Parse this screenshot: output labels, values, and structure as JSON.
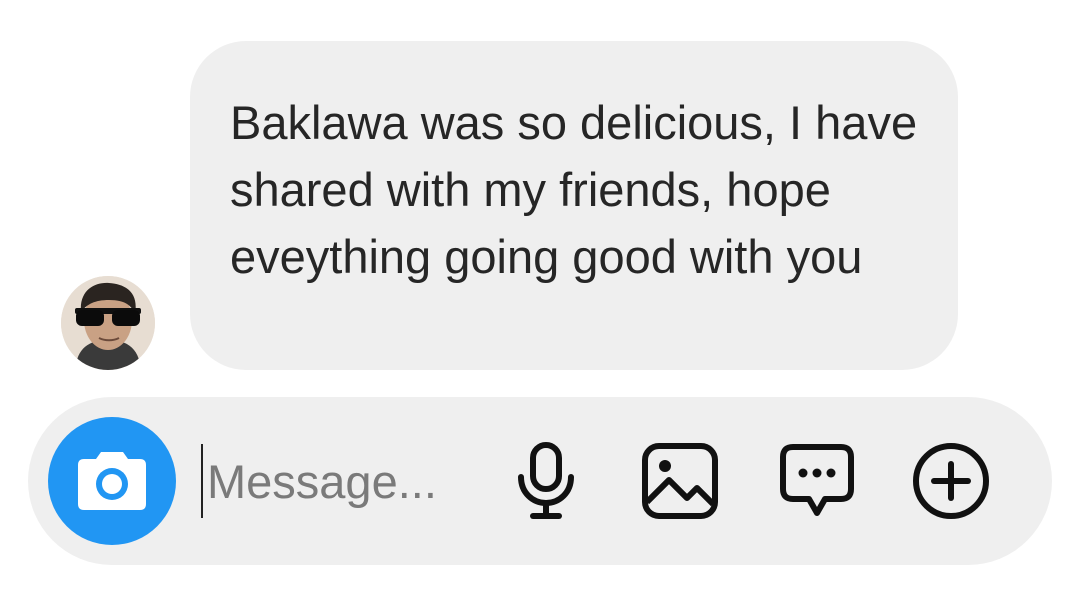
{
  "message": {
    "text": "Baklawa was so delicious, I have shared with my friends, hope eveything going good with you"
  },
  "composer": {
    "placeholder": "Message...",
    "icons": [
      "camera-icon",
      "microphone-icon",
      "gallery-icon",
      "sticker-chat-icon",
      "plus-circle-icon"
    ]
  },
  "colors": {
    "bubble": "#efefef",
    "camera_button": "#2196f3",
    "text": "#262626",
    "placeholder": "#7a7a7a"
  }
}
